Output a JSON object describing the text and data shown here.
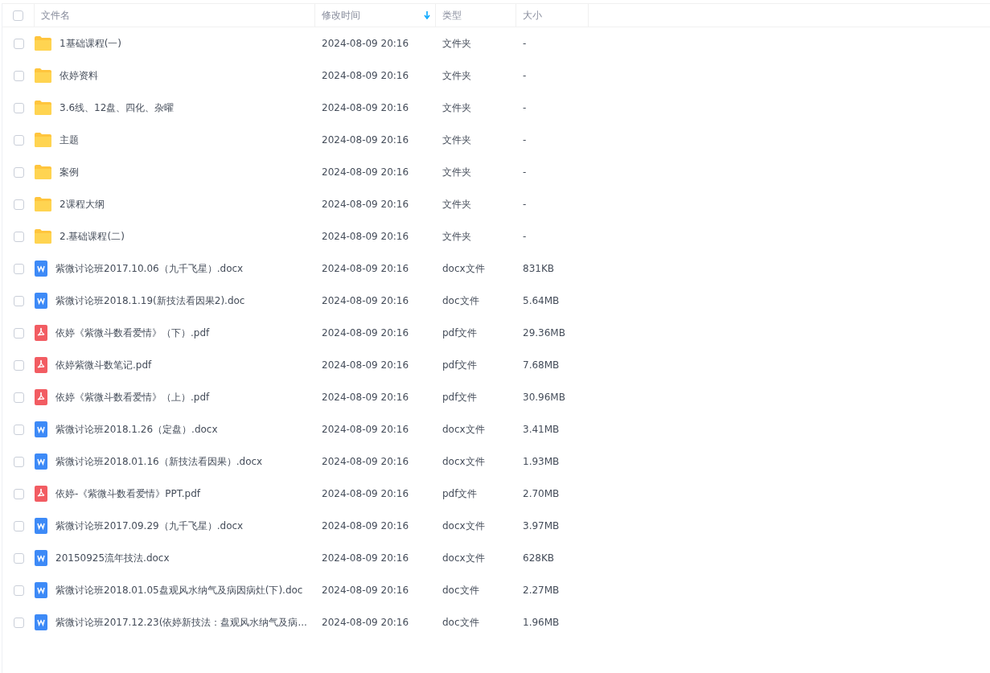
{
  "header": {
    "select_all_checked": false,
    "columns": [
      {
        "label": "文件名",
        "sorted": false
      },
      {
        "label": "修改时间",
        "sorted": true
      },
      {
        "label": "类型",
        "sorted": false
      },
      {
        "label": "大小",
        "sorted": false
      }
    ]
  },
  "rows": [
    {
      "kind": "folder",
      "name": "1基础课程(一)",
      "modified": "2024-08-09 20:16",
      "type": "文件夹",
      "size": "-",
      "checked": false
    },
    {
      "kind": "folder",
      "name": "依婷资料",
      "modified": "2024-08-09 20:16",
      "type": "文件夹",
      "size": "-",
      "checked": false
    },
    {
      "kind": "folder",
      "name": "3.6线、12盘、四化、杂曜",
      "modified": "2024-08-09 20:16",
      "type": "文件夹",
      "size": "-",
      "checked": false
    },
    {
      "kind": "folder",
      "name": "主题",
      "modified": "2024-08-09 20:16",
      "type": "文件夹",
      "size": "-",
      "checked": false
    },
    {
      "kind": "folder",
      "name": "案例",
      "modified": "2024-08-09 20:16",
      "type": "文件夹",
      "size": "-",
      "checked": false
    },
    {
      "kind": "folder",
      "name": "2课程大纲",
      "modified": "2024-08-09 20:16",
      "type": "文件夹",
      "size": "-",
      "checked": false
    },
    {
      "kind": "folder",
      "name": "2.基础课程(二)",
      "modified": "2024-08-09 20:16",
      "type": "文件夹",
      "size": "-",
      "checked": false
    },
    {
      "kind": "doc",
      "name": "紫微讨论班2017.10.06（九千飞星）.docx",
      "modified": "2024-08-09 20:16",
      "type": "docx文件",
      "size": "831KB",
      "checked": false
    },
    {
      "kind": "doc",
      "name": "紫微讨论班2018.1.19(新技法看因果2).doc",
      "modified": "2024-08-09 20:16",
      "type": "doc文件",
      "size": "5.64MB",
      "checked": false
    },
    {
      "kind": "pdf",
      "name": "依婷《紫微斗数看爱情》（下）.pdf",
      "modified": "2024-08-09 20:16",
      "type": "pdf文件",
      "size": "29.36MB",
      "checked": false
    },
    {
      "kind": "pdf",
      "name": "依婷紫微斗数笔记.pdf",
      "modified": "2024-08-09 20:16",
      "type": "pdf文件",
      "size": "7.68MB",
      "checked": false
    },
    {
      "kind": "pdf",
      "name": "依婷《紫微斗数看爱情》（上）.pdf",
      "modified": "2024-08-09 20:16",
      "type": "pdf文件",
      "size": "30.96MB",
      "checked": false
    },
    {
      "kind": "doc",
      "name": "紫微讨论班2018.1.26（定盘）.docx",
      "modified": "2024-08-09 20:16",
      "type": "docx文件",
      "size": "3.41MB",
      "checked": false
    },
    {
      "kind": "doc",
      "name": "紫微讨论班2018.01.16（新技法看因果）.docx",
      "modified": "2024-08-09 20:16",
      "type": "docx文件",
      "size": "1.93MB",
      "checked": false
    },
    {
      "kind": "pdf",
      "name": "依婷-《紫微斗数看爱情》PPT.pdf",
      "modified": "2024-08-09 20:16",
      "type": "pdf文件",
      "size": "2.70MB",
      "checked": false
    },
    {
      "kind": "doc",
      "name": "紫微讨论班2017.09.29（九千飞星）.docx",
      "modified": "2024-08-09 20:16",
      "type": "docx文件",
      "size": "3.97MB",
      "checked": false
    },
    {
      "kind": "doc",
      "name": "20150925流年技法.docx",
      "modified": "2024-08-09 20:16",
      "type": "docx文件",
      "size": "628KB",
      "checked": false
    },
    {
      "kind": "doc",
      "name": "紫微讨论班2018.01.05盘观风水纳气及病因病灶(下).doc",
      "modified": "2024-08-09 20:16",
      "type": "doc文件",
      "size": "2.27MB",
      "checked": false
    },
    {
      "kind": "doc",
      "name": "紫微讨论班2017.12.23(依婷新技法：盘观风水纳气及病...",
      "modified": "2024-08-09 20:16",
      "type": "doc文件",
      "size": "1.96MB",
      "checked": false
    }
  ]
}
